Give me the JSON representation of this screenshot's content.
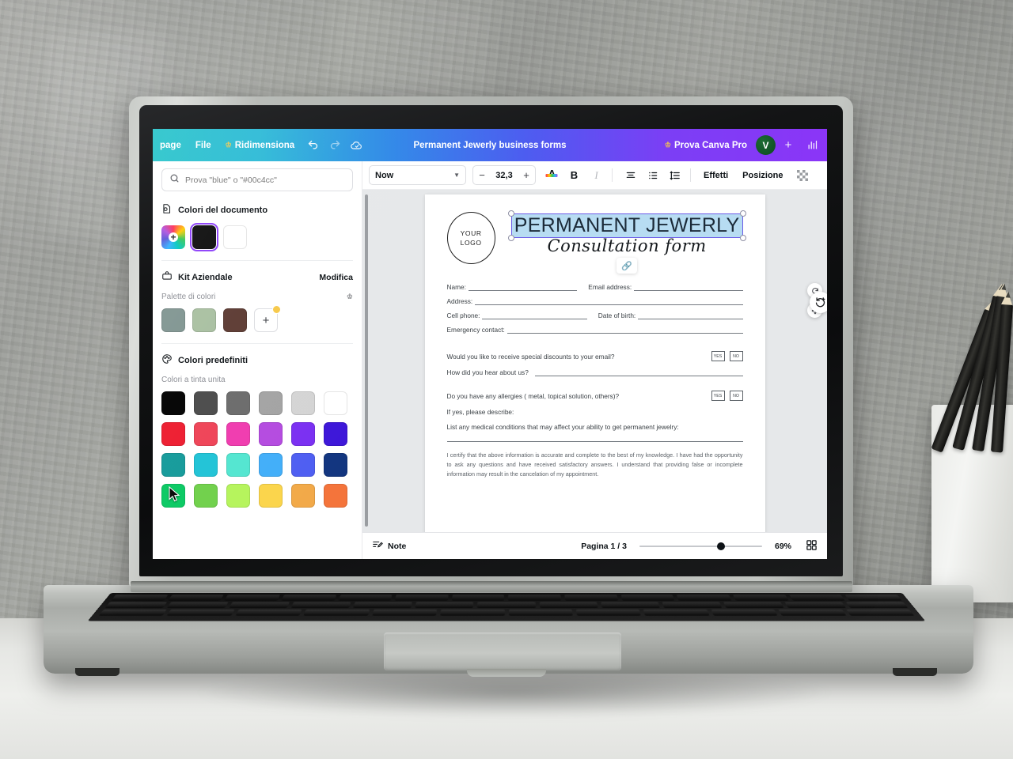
{
  "topbar": {
    "menu": [
      {
        "label": "page",
        "icon": ""
      },
      {
        "label": "File",
        "icon": ""
      },
      {
        "label": "Ridimensiona",
        "icon": "crown-icon"
      }
    ],
    "undo_icon": "undo-icon",
    "redo_icon": "redo-icon",
    "cloud_icon": "cloud-saved-icon",
    "doc_title": "Permanent Jewerly business forms",
    "try_pro": "Prova Canva Pro",
    "avatar_initial": "V",
    "plus_label": "+",
    "stats_icon": "bar-chart-icon",
    "gradient_from": "#23c3c9",
    "gradient_to": "#8b35f7"
  },
  "sidebar": {
    "search": {
      "placeholder": "Prova \"blue\" o \"#00c4cc\"",
      "value": "",
      "icon": "search-icon"
    },
    "document_colors": {
      "icon": "document-colors-icon",
      "title": "Colori del documento",
      "swatches": [
        {
          "name": "color-picker",
          "color": "rainbow",
          "selected": false
        },
        {
          "name": "black",
          "color": "#0a0a0a",
          "selected": true
        },
        {
          "name": "white",
          "color": "#ffffff",
          "selected": false
        }
      ]
    },
    "brand_kit": {
      "icon": "brand-kit-icon",
      "title": "Kit Aziendale",
      "edit_label": "Modifica",
      "palette_label": "Palette di colori",
      "pro_icon": "crown-icon",
      "colors": [
        "#7f9490",
        "#a8bfa0",
        "#5c3a32"
      ],
      "add_label": "+"
    },
    "preset_colors": {
      "icon": "palette-icon",
      "title": "Colori predefiniti",
      "solid_label": "Colori a tinta unita",
      "rows": [
        [
          "#000000",
          "#4a4a4a",
          "#6b6b6b",
          "#a3a3a3",
          "#d4d4d4",
          "#ffffff"
        ],
        [
          "#ee1b2e",
          "#ef4256",
          "#f03aae",
          "#b44ae0",
          "#7a2ff2",
          "#3d16d9"
        ],
        [
          "#139a9a",
          "#1fc3d6",
          "#52e6d0",
          "#41aef9",
          "#4e5ef2",
          "#12357f"
        ],
        [
          "#08c962",
          "#6fd04a",
          "#b5f45b",
          "#fbd košo",
          "#f2a948",
          "#f4743b"
        ]
      ],
      "row4": [
        "#08c962",
        "#6fd04a",
        "#b5f45b",
        "#fad css",
        "#f2a948",
        "#f4743b"
      ],
      "row4_fixed": [
        "#08c962",
        "#6fd04a",
        "#b5f45b",
        "#fbd54a",
        "#f2a948",
        "#f4743b"
      ],
      "hovered_swatch": "#139a9a"
    }
  },
  "toolbar": {
    "font": "Now",
    "font_chevron": "chevron-down-icon",
    "size_minus": "−",
    "size_value": "32,3",
    "size_plus": "+",
    "text_color_icon": "text-color-icon",
    "bold": "B",
    "italic": "I",
    "align_icon": "align-center-icon",
    "list_icon": "bullet-list-icon",
    "spacing_icon": "line-spacing-icon",
    "effects": "Effetti",
    "position": "Posizione",
    "transparency_icon": "transparency-icon"
  },
  "document": {
    "logo_line1": "YOUR",
    "logo_line2": "LOGO",
    "title": "PERMANENT JEWERLY",
    "subtitle": "Consultation form",
    "link_icon": "link-icon",
    "fields": [
      {
        "label": "Name:",
        "label2": "Email address:"
      },
      {
        "label": "Address:",
        "label2": ""
      },
      {
        "label": "Cell phone:",
        "label2": "Date of birth:"
      },
      {
        "label": "Emergency contact:",
        "label2": ""
      }
    ],
    "q1": "Would you like to receive special discounts to your email?",
    "q1_yes": "YES",
    "q1_no": "NO",
    "q2": "How did you hear about us?",
    "q3": "Do you have any allergies ( metal, topical solution, others)?",
    "q3_yes": "YES",
    "q3_no": "NO",
    "q4": "If yes, please describe:",
    "q5": "List any medical conditions that may affect your ability to get permanent jewelry:",
    "certification": "I certify that the above information is accurate and complete to the best of my knowledge. I have had the opportunity to ask any questions and have received satisfactory answers. I understand that providing false or incomplete information may result in the cancelation of my appointment."
  },
  "floating": {
    "rotate_small_icon": "rotate-icon",
    "move_icon": "move-icon",
    "rotate_big_icon": "rotate-add-icon"
  },
  "statusbar": {
    "note_icon": "note-icon",
    "note_label": "Note",
    "page_label": "Pagina 1 / 3",
    "zoom_value": "69%",
    "grid_icon": "grid-view-icon"
  }
}
